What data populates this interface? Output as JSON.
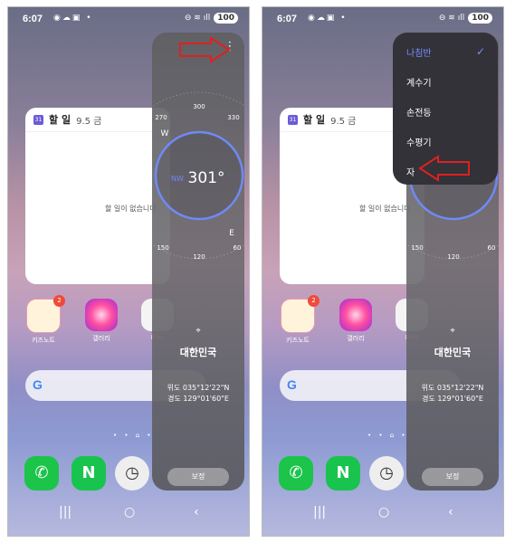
{
  "status": {
    "time": "6:07",
    "battery": "100"
  },
  "calendar_widget": {
    "icon_day": "31",
    "title": "할 일",
    "date": "9.5 금",
    "empty_text": "할 일이 없습니다"
  },
  "apps": [
    {
      "label": "키즈노트",
      "badge": "2"
    },
    {
      "label": "갤러리"
    },
    {
      "label": "Play"
    }
  ],
  "search": {
    "logo": "G"
  },
  "dock": {
    "naver_letter": "N"
  },
  "compass": {
    "heading": "301°",
    "direction": "NW",
    "ticks": [
      "300",
      "270",
      "330",
      "W",
      "E",
      "150",
      "120",
      "60"
    ],
    "country": "대한민국",
    "latitude": "위도 035°12'22\"N",
    "longitude": "경도 129°01'60\"E",
    "calibrate_label": "보정"
  },
  "menu": {
    "items": [
      "나침반",
      "계수기",
      "손전등",
      "수평기",
      "자"
    ],
    "selected": "나침반"
  },
  "colors": {
    "accent": "#6f8af5",
    "arrow": "#e02020"
  }
}
